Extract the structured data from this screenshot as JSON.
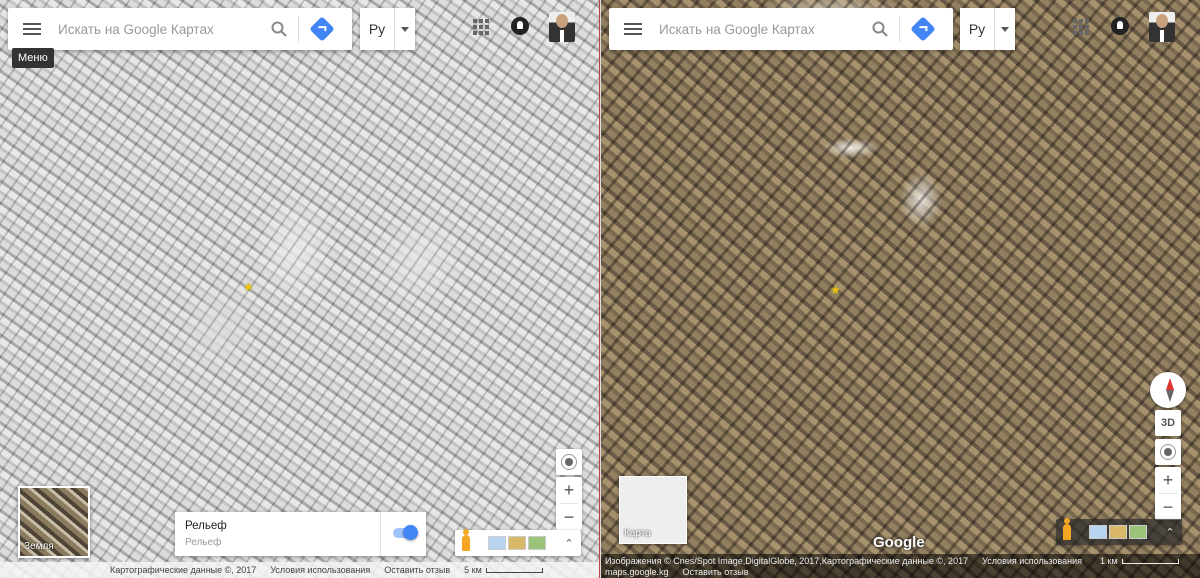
{
  "search": {
    "placeholder": "Искать на Google Картах"
  },
  "lang": {
    "label": "Ру"
  },
  "tooltip": {
    "menu": "Меню"
  },
  "left": {
    "minimap_label": "Земля",
    "relief_title": "Рельеф",
    "relief_sub": "Рельеф",
    "relief_enabled": true,
    "footer": {
      "data": "Картографические данные ©, 2017",
      "terms": "Условия использования",
      "feedback": "Оставить отзыв",
      "scale": "5 км"
    }
  },
  "right": {
    "minimap_label": "Карта",
    "btn_3d": "3D",
    "logo": "Google",
    "footer": {
      "imagery": "Изображения © Cnes/Spot Image,DigitalGlobe, 2017,Картографические данные ©, 2017",
      "terms": "Условия использования",
      "scale": "1 км",
      "domain": "maps.google.kg",
      "feedback": "Оставить отзыв"
    }
  },
  "zoom": {
    "in": "+",
    "out": "−"
  },
  "colors": {
    "accent": "#4285f4",
    "star": "#f4c20d"
  }
}
